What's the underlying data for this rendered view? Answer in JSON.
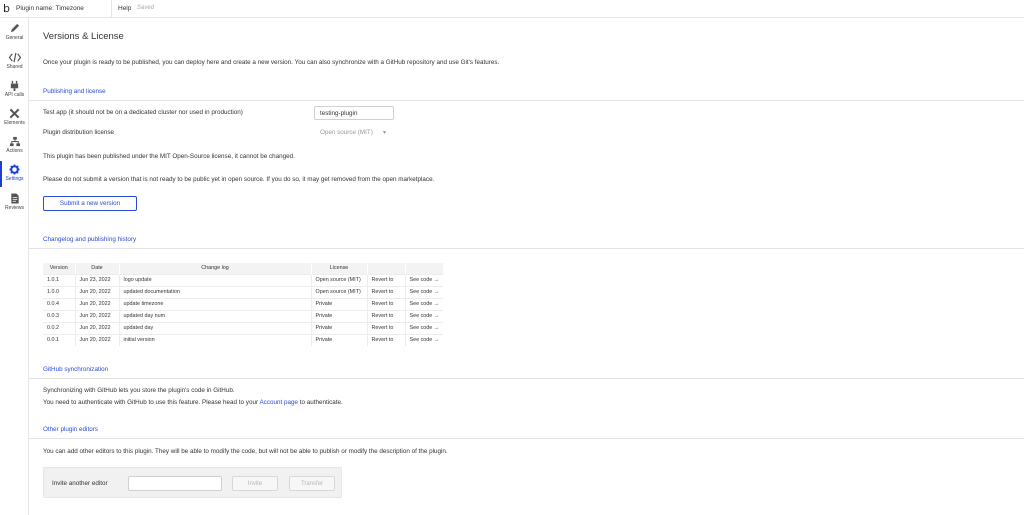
{
  "topbar": {
    "logo": "b",
    "plugin_name": "Plugin name: Timezone",
    "help": "Help",
    "saved": "Saved"
  },
  "sidebar": {
    "items": [
      {
        "label": "General",
        "icon": "pen-icon"
      },
      {
        "label": "Shared",
        "icon": "code-icon"
      },
      {
        "label": "API calls",
        "icon": "plug-icon"
      },
      {
        "label": "Elements",
        "icon": "tools-icon"
      },
      {
        "label": "Actions",
        "icon": "workflow-icon"
      },
      {
        "label": "Settings",
        "icon": "gear-icon",
        "active": true
      },
      {
        "label": "Reviews",
        "icon": "document-icon"
      }
    ],
    "active_color": "#1a3fd6"
  },
  "main": {
    "title": "Versions & License",
    "intro": "Once your plugin is ready to be published, you can deploy here and create a new version. You can also synchronize with a GitHub repository and use Git's features.",
    "publishing": {
      "section_title": "Publishing and license",
      "test_app_label": "Test app (it should not be on a dedicated cluster nor used in production)",
      "test_app_value": "testing-plugin",
      "distribution_label": "Plugin distribution license",
      "distribution_value": "Open source (MIT)",
      "published_note": "This plugin has been published under the MIT Open-Source license, it cannot be changed.",
      "warning": "Please do not submit a version that is not ready to be public yet in open source. If you do so, it may get removed from the open marketplace.",
      "submit_label": "Submit a new version"
    },
    "changelog": {
      "section_title": "Changelog and publishing history",
      "headers": [
        "Version",
        "Date",
        "Change log",
        "License",
        "",
        ""
      ],
      "rows": [
        {
          "version": "1.0.1",
          "date": "Jun 23, 2022",
          "log": "logo update",
          "license": "Open source (MIT)",
          "revert": "Revert to",
          "see": "See code →"
        },
        {
          "version": "1.0.0",
          "date": "Jun 20, 2022",
          "log": "updated documentation",
          "license": "Open source (MIT)",
          "revert": "Revert to",
          "see": "See code →"
        },
        {
          "version": "0.0.4",
          "date": "Jun 20, 2022",
          "log": "update timezone",
          "license": "Private",
          "revert": "Revert to",
          "see": "See code →"
        },
        {
          "version": "0.0.3",
          "date": "Jun 20, 2022",
          "log": "updated day num",
          "license": "Private",
          "revert": "Revert to",
          "see": "See code →"
        },
        {
          "version": "0.0.2",
          "date": "Jun 20, 2022",
          "log": "updated day",
          "license": "Private",
          "revert": "Revert to",
          "see": "See code →"
        },
        {
          "version": "0.0.1",
          "date": "Jun 20, 2022",
          "log": "initial version",
          "license": "Private",
          "revert": "Revert to",
          "see": "See code →"
        }
      ]
    },
    "github": {
      "section_title": "GitHub synchronization",
      "line1": "Synchronizing with GitHub lets you store the plugin's code in GitHub.",
      "line2_before": "You need to authenticate with GitHub to use this feature. Please head to your ",
      "line2_link": "Account page",
      "line2_after": " to authenticate."
    },
    "editors": {
      "section_title": "Other plugin editors",
      "description": "You can add other editors to this plugin. They will be able to modify the code, but will not be able to publish or modify the description of the plugin.",
      "invite_label": "Invite another editor",
      "invite_value": "",
      "invite_button": "Invite",
      "transfer_button": "Transfer"
    },
    "accent_color": "#2a4bd7"
  }
}
